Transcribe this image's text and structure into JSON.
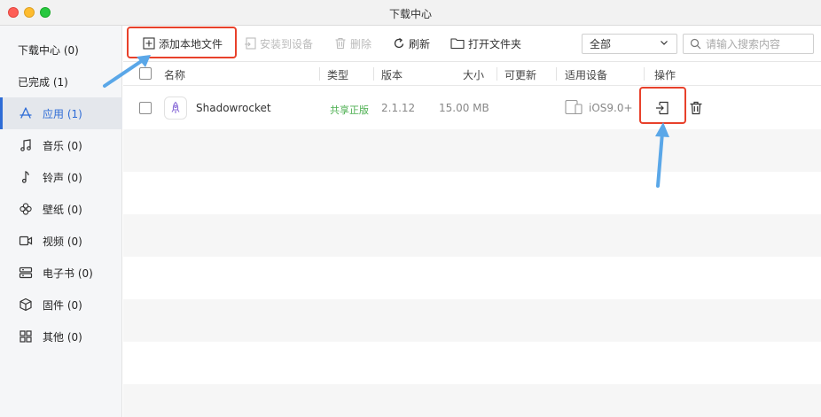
{
  "window": {
    "title": "下载中心"
  },
  "sidebar": {
    "items": [
      {
        "label": "下载中心 (0)",
        "icon": "none"
      },
      {
        "label": "已完成 (1)",
        "icon": "none"
      },
      {
        "label": "应用 (1)",
        "icon": "app-store-icon",
        "active": true
      },
      {
        "label": "音乐 (0)",
        "icon": "music-note-icon"
      },
      {
        "label": "铃声 (0)",
        "icon": "ringtone-icon"
      },
      {
        "label": "壁纸 (0)",
        "icon": "flower-icon"
      },
      {
        "label": "视频 (0)",
        "icon": "video-icon"
      },
      {
        "label": "电子书 (0)",
        "icon": "ebook-icon"
      },
      {
        "label": "固件 (0)",
        "icon": "cube-icon"
      },
      {
        "label": "其他 (0)",
        "icon": "grid-icon"
      }
    ]
  },
  "toolbar": {
    "add_local_file": "添加本地文件",
    "install_to_device": "安装到设备",
    "delete": "删除",
    "refresh": "刷新",
    "open_folder": "打开文件夹",
    "filter_selected": "全部",
    "search_placeholder": "请输入搜索内容"
  },
  "table": {
    "columns": [
      "名称",
      "类型",
      "版本",
      "大小",
      "可更新",
      "适用设备",
      "操作"
    ],
    "rows": [
      {
        "name": "Shadowrocket",
        "type": "共享正版",
        "version": "2.1.12",
        "size": "15.00 MB",
        "updatable": "",
        "device": "iOS9.0+"
      }
    ]
  },
  "colors": {
    "accent": "#2e6cd6",
    "highlight": "#e8412b",
    "annotation_arrow": "#5aa7e8",
    "badge_green": "#4caf50"
  }
}
